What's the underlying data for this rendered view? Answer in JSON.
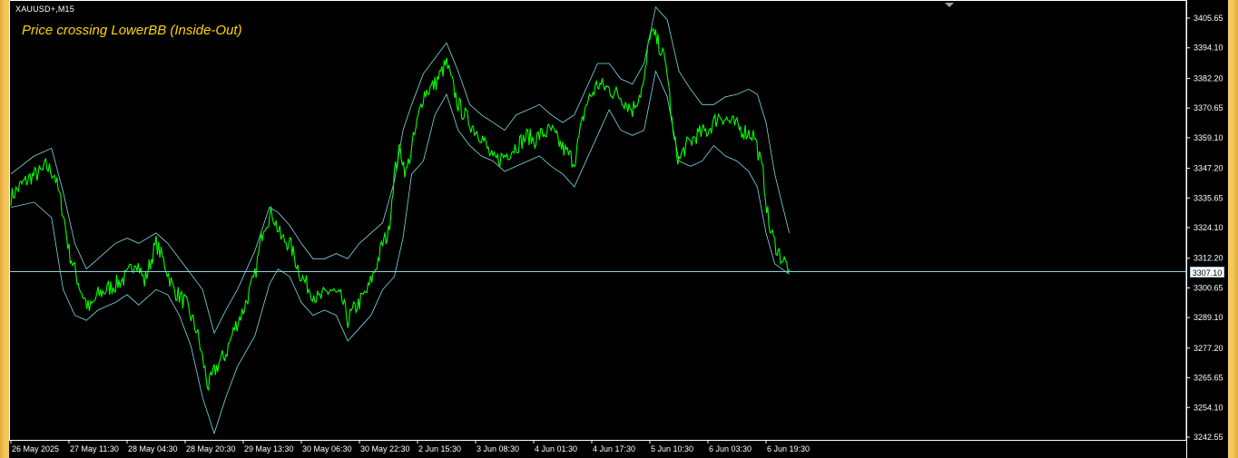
{
  "chart": {
    "symbol_label": "XAUUSD+,M15",
    "signal_label": "Price crossing LowerBB (Inside-Out)",
    "current_price_label": "3307.10",
    "colors": {
      "background": "#000000",
      "price_line": "#00ff00",
      "bollinger": "#7fd9e6",
      "current_price_line": "#8fd0dc",
      "axis_text": "#ffffff",
      "signal_text": "#ffd400"
    }
  },
  "chart_data": {
    "type": "line",
    "title": "",
    "xlabel": "",
    "ylabel": "",
    "x_ticks": [
      "26 May 2025",
      "27 May 11:30",
      "28 May 04:30",
      "28 May 20:30",
      "29 May 13:30",
      "30 May 06:30",
      "30 May 22:30",
      "2 Jun 15:30",
      "3 Jun 08:30",
      "4 Jun 01:30",
      "4 Jun 17:30",
      "5 Jun 10:30",
      "6 Jun 03:30",
      "6 Jun 19:30"
    ],
    "y_ticks": [
      3405.65,
      3394.1,
      3382.2,
      3370.65,
      3359.1,
      3347.2,
      3335.65,
      3324.1,
      3312.2,
      3300.65,
      3289.1,
      3277.2,
      3265.65,
      3254.1,
      3242.55
    ],
    "ylim": [
      3242.55,
      3405.65
    ],
    "current_price": 3307.1,
    "series": [
      {
        "role": "price",
        "x": [
          0,
          0.15,
          0.35,
          0.55,
          0.6,
          0.75,
          0.9,
          1.0,
          1.2,
          1.35,
          1.5,
          1.8,
          2.0,
          2.15,
          2.3,
          2.5,
          2.65,
          2.8,
          3.0,
          3.2,
          3.4,
          3.5,
          3.6,
          3.7,
          3.85,
          4.0,
          4.2,
          4.35,
          4.5,
          4.65,
          4.8,
          5.0,
          5.15,
          5.3,
          5.5,
          5.7,
          5.8,
          5.9,
          6.0,
          6.15,
          6.3,
          6.4,
          6.5,
          6.6,
          6.7,
          6.8,
          6.95,
          7.1,
          7.3,
          7.5,
          7.7,
          7.9,
          8.0,
          8.1,
          8.3,
          8.5,
          8.7,
          8.9,
          9.0,
          9.1,
          9.3,
          9.5,
          9.7,
          9.9,
          10.1,
          10.3,
          10.5,
          10.7,
          10.9,
          11.0,
          11.1,
          11.2,
          11.3,
          11.4,
          11.5,
          11.6,
          11.8,
          12.0,
          12.2,
          12.4,
          12.6,
          12.8,
          12.95,
          13.05,
          13.15,
          13.25,
          13.4
        ],
        "values": [
          3336,
          3340,
          3344,
          3346,
          3348,
          3345,
          3330,
          3315,
          3300,
          3292,
          3298,
          3302,
          3305,
          3312,
          3303,
          3318,
          3310,
          3300,
          3295,
          3284,
          3262,
          3268,
          3272,
          3275,
          3285,
          3292,
          3305,
          3325,
          3330,
          3320,
          3318,
          3305,
          3300,
          3296,
          3300,
          3296,
          3288,
          3292,
          3295,
          3300,
          3310,
          3318,
          3322,
          3345,
          3355,
          3345,
          3360,
          3376,
          3380,
          3388,
          3372,
          3365,
          3362,
          3360,
          3350,
          3352,
          3356,
          3360,
          3358,
          3360,
          3362,
          3355,
          3350,
          3372,
          3380,
          3378,
          3375,
          3370,
          3380,
          3400,
          3398,
          3393,
          3385,
          3360,
          3350,
          3355,
          3360,
          3362,
          3368,
          3365,
          3362,
          3360,
          3345,
          3325,
          3318,
          3313,
          3308
        ]
      },
      {
        "role": "upper_band",
        "x": [
          0,
          0.4,
          0.7,
          0.9,
          1.1,
          1.3,
          1.5,
          1.8,
          2.0,
          2.2,
          2.5,
          2.7,
          2.9,
          3.1,
          3.3,
          3.5,
          3.7,
          3.9,
          4.2,
          4.45,
          4.6,
          4.8,
          5.0,
          5.2,
          5.4,
          5.6,
          5.8,
          6.0,
          6.2,
          6.4,
          6.6,
          6.75,
          6.9,
          7.1,
          7.3,
          7.5,
          7.7,
          7.9,
          8.1,
          8.3,
          8.5,
          8.7,
          8.9,
          9.1,
          9.3,
          9.5,
          9.7,
          9.9,
          10.1,
          10.3,
          10.5,
          10.7,
          10.9,
          11.1,
          11.3,
          11.5,
          11.7,
          11.9,
          12.1,
          12.3,
          12.5,
          12.7,
          12.85,
          13.0,
          13.15,
          13.4
        ],
        "values": [
          3345,
          3352,
          3355,
          3338,
          3318,
          3308,
          3312,
          3318,
          3320,
          3318,
          3322,
          3318,
          3312,
          3306,
          3300,
          3283,
          3292,
          3300,
          3315,
          3332,
          3330,
          3325,
          3318,
          3312,
          3312,
          3314,
          3312,
          3318,
          3322,
          3326,
          3342,
          3362,
          3372,
          3384,
          3390,
          3396,
          3385,
          3372,
          3368,
          3365,
          3362,
          3368,
          3370,
          3372,
          3368,
          3365,
          3368,
          3378,
          3388,
          3388,
          3382,
          3380,
          3388,
          3410,
          3405,
          3385,
          3378,
          3372,
          3372,
          3375,
          3376,
          3378,
          3376,
          3365,
          3345,
          3322
        ]
      },
      {
        "role": "lower_band",
        "x": [
          0,
          0.4,
          0.7,
          0.9,
          1.1,
          1.3,
          1.5,
          1.8,
          2.0,
          2.2,
          2.5,
          2.7,
          2.9,
          3.1,
          3.3,
          3.5,
          3.7,
          3.9,
          4.2,
          4.45,
          4.6,
          4.8,
          5.0,
          5.2,
          5.4,
          5.6,
          5.8,
          6.0,
          6.2,
          6.4,
          6.6,
          6.75,
          6.9,
          7.1,
          7.3,
          7.5,
          7.7,
          7.9,
          8.1,
          8.3,
          8.5,
          8.7,
          8.9,
          9.1,
          9.3,
          9.5,
          9.7,
          9.9,
          10.1,
          10.3,
          10.5,
          10.7,
          10.9,
          11.1,
          11.3,
          11.5,
          11.7,
          11.9,
          12.1,
          12.3,
          12.5,
          12.7,
          12.85,
          13.0,
          13.15,
          13.4
        ],
        "values": [
          3332,
          3334,
          3328,
          3300,
          3290,
          3288,
          3292,
          3295,
          3298,
          3294,
          3300,
          3298,
          3290,
          3278,
          3258,
          3244,
          3258,
          3270,
          3282,
          3302,
          3308,
          3305,
          3295,
          3290,
          3292,
          3290,
          3280,
          3285,
          3290,
          3300,
          3305,
          3320,
          3345,
          3350,
          3368,
          3376,
          3362,
          3356,
          3352,
          3350,
          3346,
          3348,
          3350,
          3352,
          3348,
          3345,
          3340,
          3350,
          3360,
          3370,
          3362,
          3360,
          3362,
          3385,
          3375,
          3350,
          3348,
          3350,
          3356,
          3352,
          3350,
          3346,
          3340,
          3322,
          3310,
          3306
        ]
      }
    ]
  }
}
